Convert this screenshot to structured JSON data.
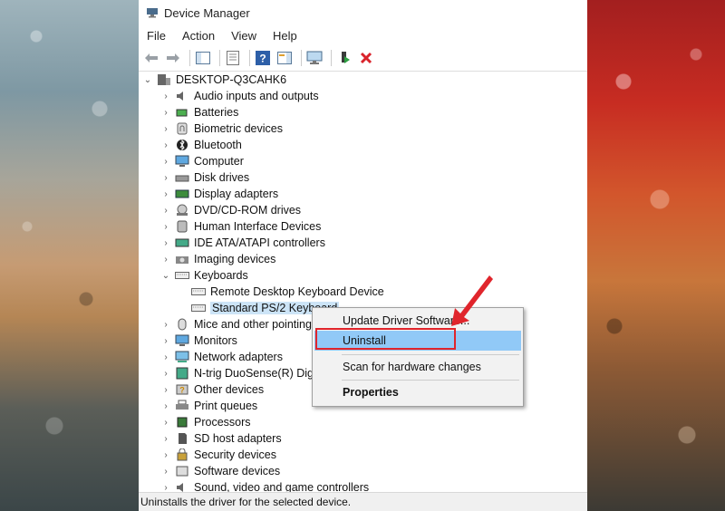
{
  "window": {
    "title": "Device Manager"
  },
  "menu": [
    "File",
    "Action",
    "View",
    "Help"
  ],
  "tree": {
    "root": "DESKTOP-Q3CAHK6",
    "items": [
      {
        "label": "Audio inputs and outputs",
        "icon": "speaker-icon"
      },
      {
        "label": "Batteries",
        "icon": "battery-icon"
      },
      {
        "label": "Biometric devices",
        "icon": "fingerprint-icon"
      },
      {
        "label": "Bluetooth",
        "icon": "bluetooth-icon"
      },
      {
        "label": "Computer",
        "icon": "monitor-icon"
      },
      {
        "label": "Disk drives",
        "icon": "disk-drive-icon"
      },
      {
        "label": "Display adapters",
        "icon": "display-adapter-icon"
      },
      {
        "label": "DVD/CD-ROM drives",
        "icon": "dvd-drive-icon"
      },
      {
        "label": "Human Interface Devices",
        "icon": "hid-icon"
      },
      {
        "label": "IDE ATA/ATAPI controllers",
        "icon": "ide-controller-icon"
      },
      {
        "label": "Imaging devices",
        "icon": "camera-icon"
      },
      {
        "label": "Keyboards",
        "icon": "keyboard-icon"
      },
      {
        "label": "Mice and other pointing",
        "icon": "mouse-icon"
      },
      {
        "label": "Monitors",
        "icon": "monitor-icon"
      },
      {
        "label": "Network adapters",
        "icon": "network-icon"
      },
      {
        "label": "N-trig DuoSense(R) Digit",
        "icon": "digitizer-icon"
      },
      {
        "label": "Other devices",
        "icon": "unknown-device-icon"
      },
      {
        "label": "Print queues",
        "icon": "printer-icon"
      },
      {
        "label": "Processors",
        "icon": "cpu-icon"
      },
      {
        "label": "SD host adapters",
        "icon": "sd-card-icon"
      },
      {
        "label": "Security devices",
        "icon": "security-icon"
      },
      {
        "label": "Software devices",
        "icon": "software-device-icon"
      },
      {
        "label": "Sound, video and game controllers",
        "icon": "sound-icon"
      }
    ],
    "keyboards_children": [
      "Remote Desktop Keyboard Device",
      "Standard PS/2 Keyboard"
    ]
  },
  "context_menu": {
    "update": "Update Driver Software...",
    "uninstall": "Uninstall",
    "scan": "Scan for hardware changes",
    "properties": "Properties"
  },
  "status": "Uninstalls the driver for the selected device.",
  "colors": {
    "highlight": "#91c9f7",
    "selection": "#cce4f7",
    "annotation": "#e0252c"
  }
}
